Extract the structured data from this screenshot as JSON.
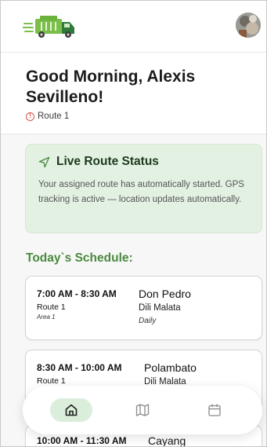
{
  "header": {
    "logo_icon": "garbage-truck-logo",
    "avatar_icon": "user-avatar"
  },
  "greeting": {
    "title": "Good Morning, Alexis Sevilleno!",
    "route_label": "Route 1",
    "alert_icon": "alert-circle-icon"
  },
  "live_status": {
    "icon": "navigation-icon",
    "title": "Live Route Status",
    "body": "Your assigned route has automatically started. GPS tracking is active — location updates automatically."
  },
  "schedule": {
    "title": "Today`s Schedule:",
    "items": [
      {
        "time": "7:00 AM - 8:30 AM",
        "route": "Route 1",
        "area": "Area 1",
        "location": "Don Pedro",
        "sublocation": "Dili Malata",
        "frequency": "Daily"
      },
      {
        "time": "8:30 AM - 10:00 AM",
        "route": "Route 1",
        "location": "Polambato",
        "sublocation": "Dili Malata"
      },
      {
        "time": "10:00 AM - 11:30 AM",
        "location": "Cayang"
      }
    ]
  },
  "bottom_nav": {
    "items": [
      {
        "icon": "home-icon",
        "active": true
      },
      {
        "icon": "map-icon",
        "active": false
      },
      {
        "icon": "calendar-icon",
        "active": false
      }
    ]
  },
  "colors": {
    "accent_green": "#4a8a3e",
    "live_bg": "#e3f1e3",
    "alert_red": "#d9534f",
    "active_nav_bg": "#dbeedb"
  }
}
